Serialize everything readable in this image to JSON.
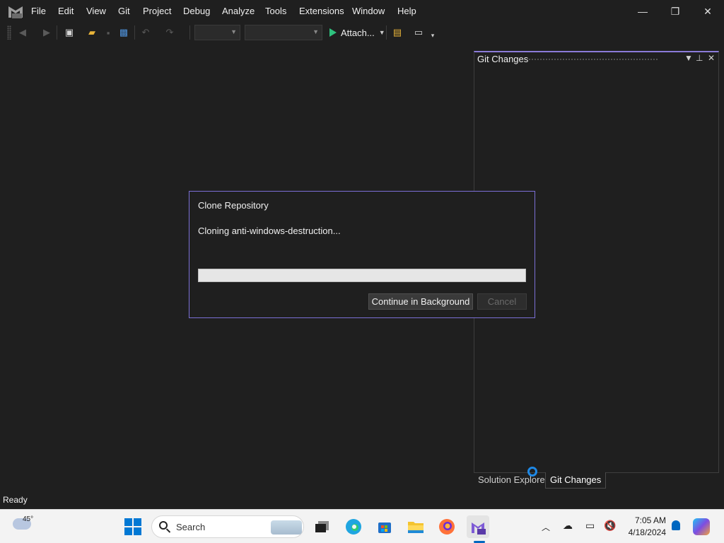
{
  "menu": {
    "items": [
      "File",
      "Edit",
      "View",
      "Git",
      "Project",
      "Debug",
      "Analyze",
      "Tools",
      "Extensions",
      "Window",
      "Help"
    ]
  },
  "window_controls": {
    "minimize": "—",
    "restore": "❐",
    "close": "✕"
  },
  "toolbar": {
    "attach_label": "Attach...",
    "icons": [
      "back-icon",
      "forward-icon",
      "new-project-icon",
      "open-folder-icon",
      "save-icon",
      "save-all-icon",
      "undo-icon",
      "redo-icon",
      "solution-explorer-icon",
      "window-layout-icon"
    ]
  },
  "git_pane": {
    "title": "Git Changes"
  },
  "bottom_tabs": {
    "solution_explorer": "Solution Explorer",
    "git_changes": "Git Changes"
  },
  "dialog": {
    "title": "Clone Repository",
    "status": "Cloning anti-windows-destruction...",
    "progress": 0,
    "continue_label": "Continue in Background",
    "cancel_label": "Cancel"
  },
  "status_bar": {
    "text": "Ready"
  },
  "taskbar": {
    "weather_temp": "45°",
    "search_label": "Search",
    "clock_time": "7:05 AM",
    "clock_date": "4/18/2024",
    "accent": "#0067c0"
  },
  "colors": {
    "background": "#1f1f1f",
    "dialog_border": "#7b6fd6",
    "pane_accent": "#8a7ad8",
    "run_green": "#2ec27e"
  }
}
